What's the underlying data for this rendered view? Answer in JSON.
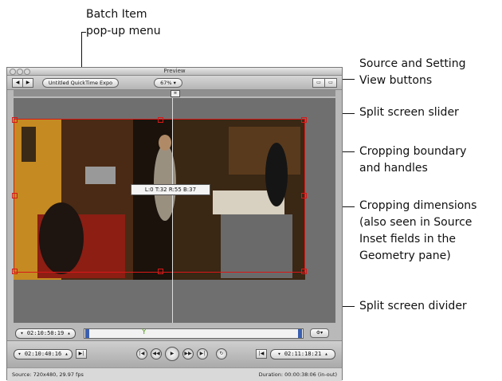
{
  "callouts": {
    "batch_item_l1": "Batch Item",
    "batch_item_l2": "pop-up menu",
    "source_setting_l1": "Source and Setting",
    "source_setting_l2": "View buttons",
    "split_slider": "Split screen slider",
    "crop_boundary_l1": "Cropping boundary",
    "crop_boundary_l2": "and handles",
    "crop_dims_l1": "Cropping dimensions",
    "crop_dims_l2": "(also seen in Source",
    "crop_dims_l3": "Inset fields in the",
    "crop_dims_l4": "Geometry pane)",
    "split_divider": "Split screen divider"
  },
  "window": {
    "title": "Preview",
    "batch_item_value": "Untitled QuickTime Expo",
    "zoom": "67%",
    "crop_dimensions": "L:0 T:32 R:55 B:37",
    "timecode_current": "02:10:50:19",
    "timecode_in": "02:10:40:16",
    "timecode_out": "02:11:18:21",
    "status_source": "Source: 720x480, 29.97 fps",
    "status_duration": "Duration: 00:00:38:06 (in-out)"
  }
}
